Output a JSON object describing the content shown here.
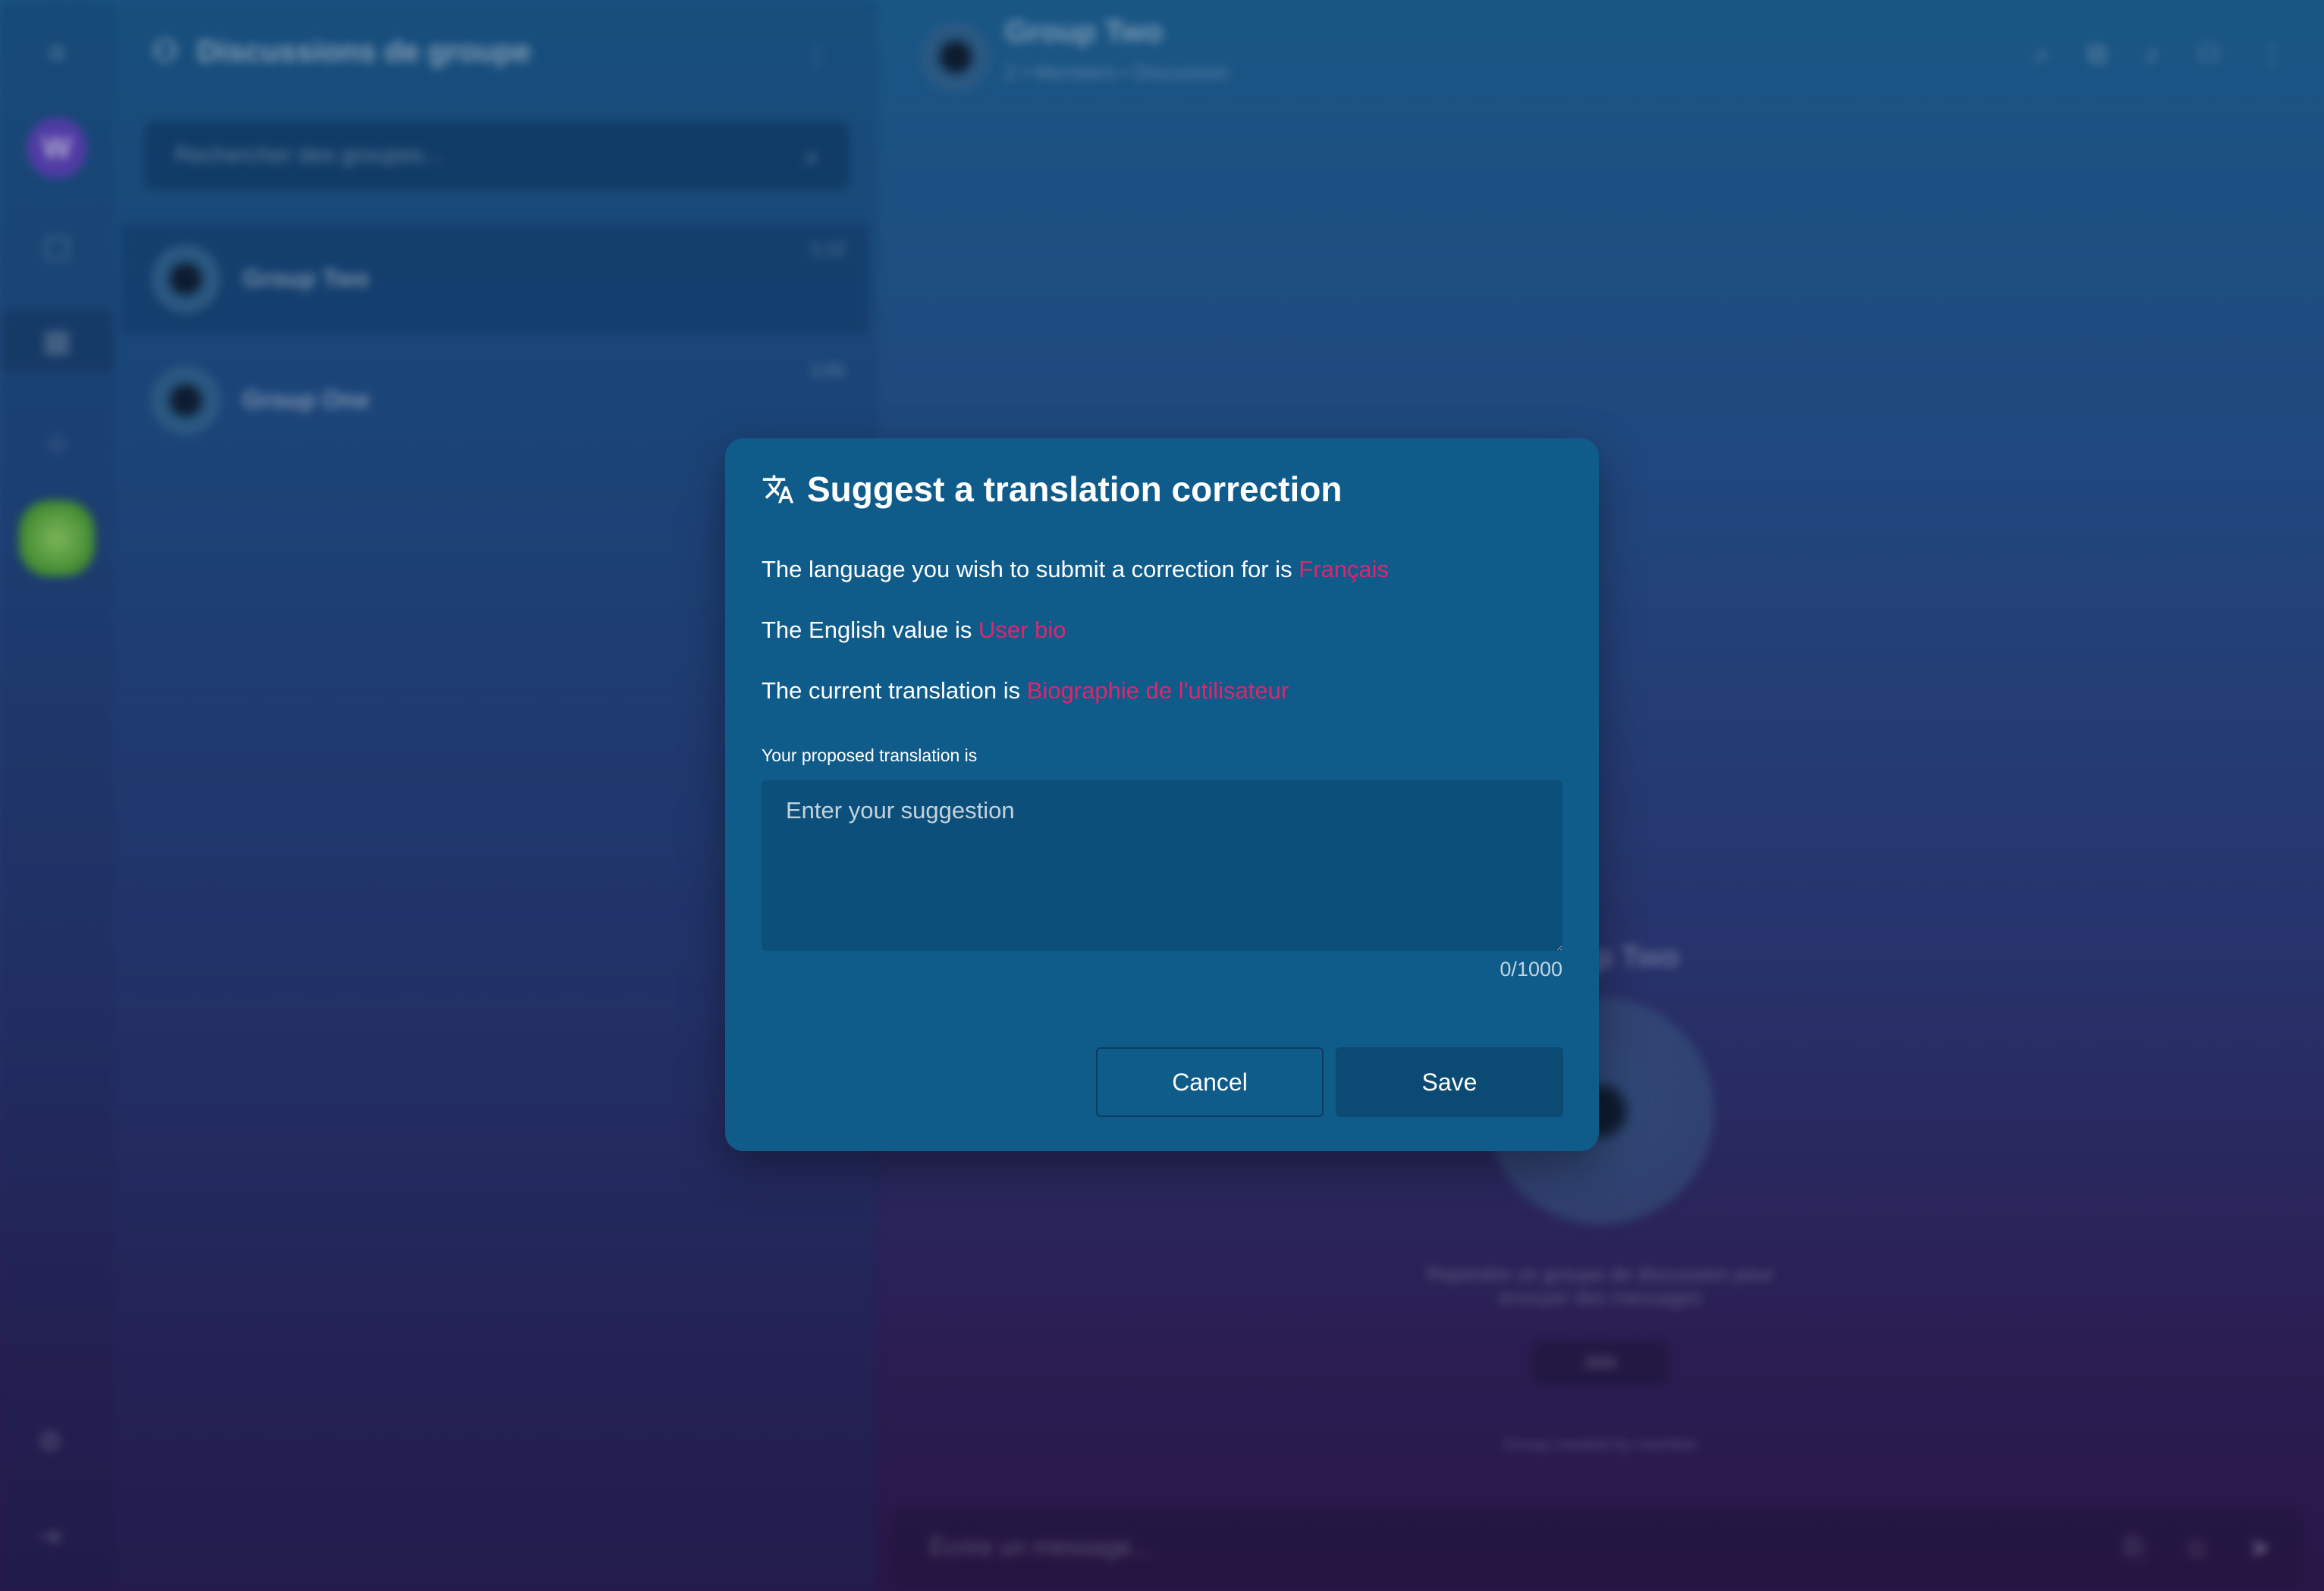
{
  "background": {
    "list_title": "Discussions de groupe",
    "search_placeholder": "Rechercher des groupes...",
    "chats": [
      {
        "name": "Group Two",
        "time": "1:12"
      },
      {
        "name": "Group One",
        "time": "1:01"
      }
    ],
    "main_title": "Group Two",
    "main_subtitle": "2 • Members • Discussion",
    "center_title": "Group Two",
    "center_text": "Rejoindre ce groupe de discussion pour envoyer des messages",
    "center_button": "Join",
    "center_footer": "Group created by member",
    "composer_placeholder": "Écrire un message..."
  },
  "modal": {
    "title": "Suggest a translation correction",
    "language_prefix": "The language you wish to submit a correction for is ",
    "language_value": "Français",
    "english_prefix": "The English value is ",
    "english_value": "User bio",
    "current_prefix": "The current translation is ",
    "current_value": "Biographie de l'utilisateur",
    "field_label": "Your proposed translation is",
    "placeholder": "Enter your suggestion",
    "counter": "0/1000",
    "cancel_label": "Cancel",
    "save_label": "Save"
  },
  "colors": {
    "modal_bg": "#0f5b8a",
    "accent": "#e0256e",
    "input_bg": "#0c4f7a",
    "save_bg": "#0b4b73"
  }
}
